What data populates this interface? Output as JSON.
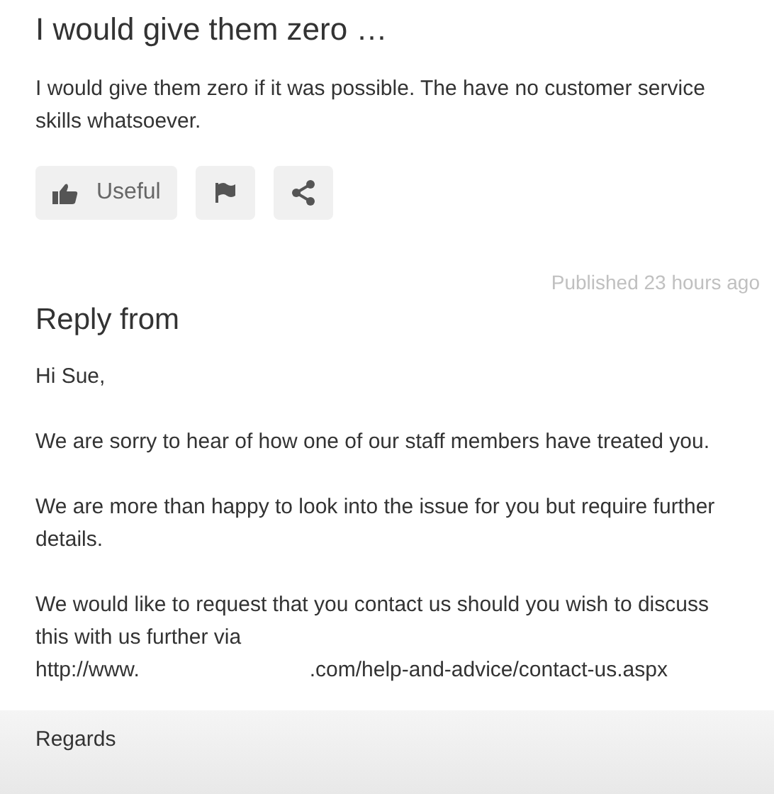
{
  "review": {
    "title": "I would give them zero …",
    "body": "I would give them zero if it was possible. The have no customer service skills whatsoever.",
    "actions": [
      {
        "kind": "useful",
        "label": "Useful"
      },
      {
        "kind": "flag"
      },
      {
        "kind": "share"
      }
    ]
  },
  "reply": {
    "published": "Published 23 hours ago",
    "heading": "Reply from",
    "paragraphs": [
      "Hi Sue,",
      "We are sorry to hear of how one of our staff members have treated you.",
      "We are more than happy to look into the issue for you but require further details.",
      "We would like to request that you contact us should you wish to discuss this with us further via"
    ],
    "url_start": "http://www.",
    "url_end": ".com/help-and-advice/contact-us.aspx",
    "closing": "Regards"
  }
}
